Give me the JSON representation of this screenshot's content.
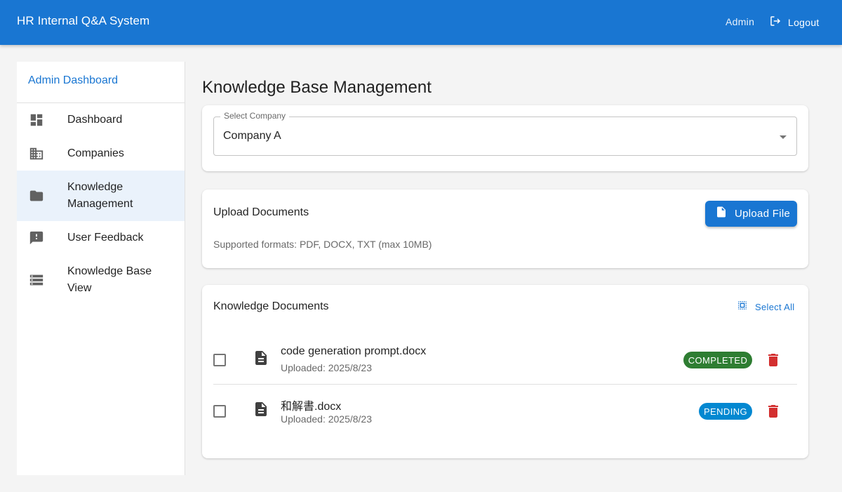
{
  "header": {
    "title": "HR Internal Q&A System",
    "user_label": "Admin",
    "logout_label": "Logout",
    "bg_color": "#1976d2"
  },
  "sidebar": {
    "title": "Admin Dashboard",
    "items": [
      {
        "label": "Dashboard",
        "icon": "dashboard-icon",
        "active": false
      },
      {
        "label": "Companies",
        "icon": "business-icon",
        "active": false
      },
      {
        "label": "Knowledge Management",
        "icon": "folder-icon",
        "active": true
      },
      {
        "label": "User Feedback",
        "icon": "feedback-icon",
        "active": false
      },
      {
        "label": "Knowledge Base View",
        "icon": "storage-icon",
        "active": false
      }
    ]
  },
  "main": {
    "title": "Knowledge Base Management",
    "company_select": {
      "label": "Select Company",
      "value": "Company A"
    },
    "upload": {
      "heading": "Upload Documents",
      "button_label": "Upload File",
      "supported_formats": "Supported formats: PDF, DOCX, TXT (max 10MB)"
    },
    "documents": {
      "heading": "Knowledge Documents",
      "select_all_label": "Select All",
      "items": [
        {
          "name": "code generation prompt.docx",
          "uploaded": "Uploaded: 2025/8/23",
          "status": "COMPLETED",
          "status_color": "#2e7d32",
          "checked": false
        },
        {
          "name": "和解書.docx",
          "uploaded": "Uploaded: 2025/8/23",
          "status": "PENDING",
          "status_color": "#0288d1",
          "checked": false
        }
      ]
    }
  }
}
